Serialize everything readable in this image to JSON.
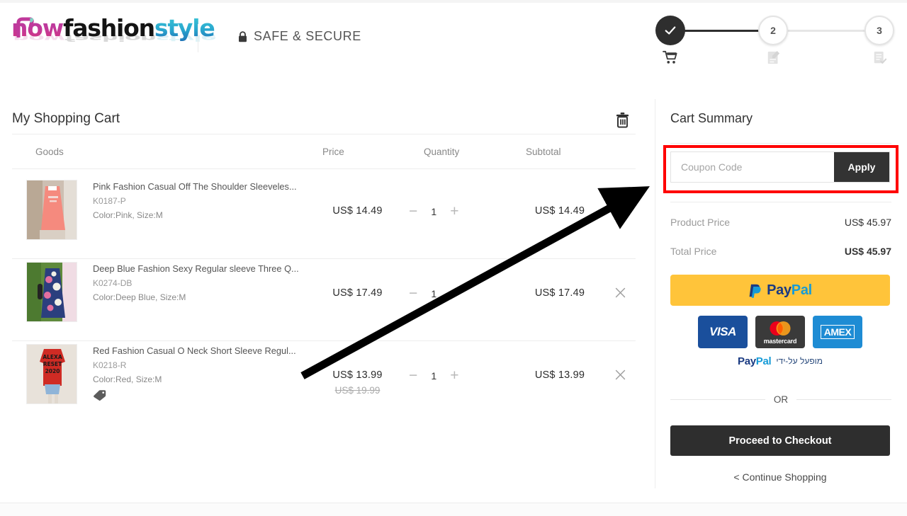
{
  "header": {
    "logo": {
      "part1": "now",
      "part2": "fashion",
      "part3": "style",
      "alt": "KnowFashionStyle"
    },
    "safe_secure_label": "SAFE & SECURE",
    "lock_icon": "lock-icon"
  },
  "steps": [
    {
      "id": "cart",
      "label": "✓",
      "icon": "shopping-cart-icon",
      "state": "active"
    },
    {
      "id": "address",
      "label": "2",
      "icon": "form-edit-icon",
      "state": "idle"
    },
    {
      "id": "payment",
      "label": "3",
      "icon": "document-check-icon",
      "state": "idle"
    }
  ],
  "cart": {
    "title": "My Shopping Cart",
    "clear_icon": "trash-icon",
    "columns": {
      "goods": "Goods",
      "price": "Price",
      "quantity": "Quantity",
      "subtotal": "Subtotal"
    },
    "items": [
      {
        "name": "Pink Fashion Casual Off The Shoulder Sleeveles...",
        "sku": "K0187-P",
        "attrs": "Color:Pink, Size:M",
        "price": "US$ 14.49",
        "old_price": "",
        "qty": "1",
        "subtotal": "US$ 14.49",
        "discount_tag": false,
        "thumb_colors": {
          "dress": "#f58a7e",
          "bg": "#d7cfc6",
          "accent": "#ffffff"
        }
      },
      {
        "name": "Deep Blue Fashion Sexy Regular sleeve Three Q...",
        "sku": "K0274-DB",
        "attrs": "Color:Deep Blue, Size:M",
        "price": "US$ 17.49",
        "old_price": "",
        "qty": "1",
        "subtotal": "US$ 17.49",
        "discount_tag": false,
        "thumb_colors": {
          "dress": "#2b3f7e",
          "bg": "#5f8a3c",
          "accent": "#e36fa0"
        }
      },
      {
        "name": "Red Fashion Casual O Neck Short Sleeve Regul...",
        "sku": "K0218-R",
        "attrs": "Color:Red, Size:M",
        "price": "US$ 13.99",
        "old_price": "US$ 19.99",
        "qty": "1",
        "subtotal": "US$ 13.99",
        "discount_tag": true,
        "thumb_text": "ALEXA RESET 2020",
        "thumb_colors": {
          "dress": "#cf2b24",
          "bg": "#e8e2da",
          "accent": "#8fb4d8"
        }
      }
    ],
    "qty_minus": "−",
    "qty_plus": "+",
    "remove_icon": "close-icon"
  },
  "summary": {
    "title": "Cart Summary",
    "coupon_placeholder": "Coupon Code",
    "coupon_value": "",
    "apply_label": "Apply",
    "product_price_label": "Product Price",
    "product_price_value": "US$ 45.97",
    "total_price_label": "Total Price",
    "total_price_value": "US$ 45.97",
    "paypal_label": "PayPal",
    "cards": [
      {
        "name": "visa-card-icon",
        "label": "VISA"
      },
      {
        "name": "mastercard-card-icon",
        "label": "mastercard"
      },
      {
        "name": "amex-card-icon",
        "label": "AMEX"
      }
    ],
    "powered_by_paypal": "PayPal",
    "powered_by_text_he": "מופעל על-ידי",
    "or_label": "OR",
    "checkout_label": "Proceed to Checkout",
    "continue_label": "< Continue Shopping"
  },
  "annotations": {
    "highlight_color": "#ff0000",
    "arrow_color": "#000000",
    "highlight_target": "coupon-code-field",
    "arrow_from": "cart-items-area",
    "arrow_to": "coupon-code-field"
  }
}
